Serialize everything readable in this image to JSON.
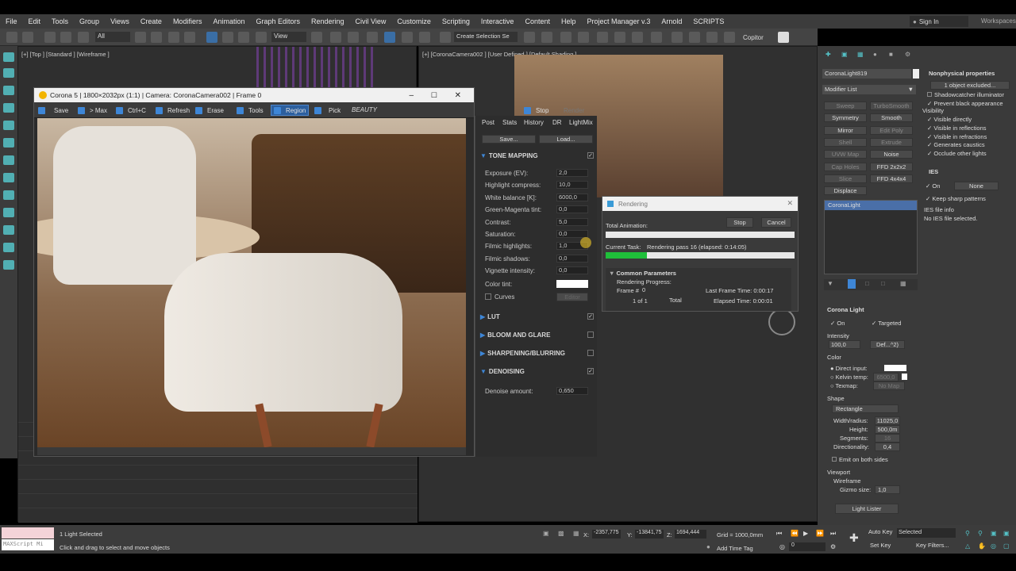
{
  "menu": [
    "File",
    "Edit",
    "Tools",
    "Group",
    "Views",
    "Create",
    "Modifiers",
    "Animation",
    "Graph Editors",
    "Rendering",
    "Civil View",
    "Customize",
    "Scripting",
    "Interactive",
    "Content",
    "Help",
    "Project Manager v.3",
    "Arnold",
    "SCRIPTS"
  ],
  "signin": "Sign In",
  "workspaces": "Workspaces",
  "toolbar": {
    "filter": "All",
    "view": "View",
    "selset": "Create Selection Se",
    "copitor": "Copitor"
  },
  "viewports": {
    "top": "[+] [Top ] [Standard ] [Wireframe ]",
    "camera": "[+] [CoronaCamera002 ] [User Defined ] [Default Shading ]"
  },
  "corona": {
    "title": "Corona 5 | 1800×2032px (1:1) | Camera: CoronaCamera002 | Frame 0",
    "buttons": [
      "Save",
      "> Max",
      "Ctrl+C",
      "Refresh",
      "Erase",
      "Tools",
      "Region",
      "Pick"
    ],
    "channel": "BEAUTY",
    "stop": "Stop",
    "render": "Render"
  },
  "post": {
    "tabs": [
      "Post",
      "Stats",
      "History",
      "DR",
      "LightMix"
    ],
    "save": "Save...",
    "load": "Load...",
    "tone": "TONE MAPPING",
    "params": [
      {
        "l": "Exposure (EV):",
        "v": "2,0"
      },
      {
        "l": "Highlight compress:",
        "v": "10,0"
      },
      {
        "l": "White balance [K]:",
        "v": "6000,0"
      },
      {
        "l": "Green-Magenta tint:",
        "v": "0,0"
      },
      {
        "l": "Contrast:",
        "v": "5,0"
      },
      {
        "l": "Saturation:",
        "v": "0,0"
      },
      {
        "l": "Filmic highlights:",
        "v": "1,0"
      },
      {
        "l": "Filmic shadows:",
        "v": "0,0"
      },
      {
        "l": "Vignette intensity:",
        "v": "0,0"
      }
    ],
    "colortint": "Color tint:",
    "curves": "Curves",
    "editor": "Editor",
    "lut": "LUT",
    "bloom": "BLOOM AND GLARE",
    "sharp": "SHARPENING/BLURRING",
    "denoise": "DENOISING",
    "denoiseamt": "Denoise amount:",
    "denoiseval": "0,650"
  },
  "rendering": {
    "title": "Rendering",
    "total": "Total Animation:",
    "stop": "Stop",
    "cancel": "Cancel",
    "task": "Current Task:",
    "taskval": "Rendering pass 16 (elapsed: 0:14:05)",
    "progress": 0.22,
    "common": "Common Parameters",
    "rprog": "Rendering Progress:",
    "frame": "Frame #",
    "frameval": "0",
    "last": "Last Frame Time: 0:00:17",
    "of": "1 of 1",
    "totallbl": "Total",
    "elapsed": "Elapsed Time: 0:00:01"
  },
  "cmd": {
    "objname": "CoronaLight819",
    "modlist": "Modifier List",
    "mods": [
      [
        "Sweep",
        "TurboSmooth"
      ],
      [
        "Symmetry",
        "Smooth"
      ],
      [
        "Mirror",
        "Edit Poly"
      ],
      [
        "Shell",
        "Extrude"
      ],
      [
        "UVW Map",
        "Noise"
      ],
      [
        "Cap Holes",
        "FFD 2x2x2"
      ],
      [
        "Slice",
        "FFD 4x4x4"
      ],
      [
        "Displace",
        ""
      ]
    ],
    "stack": "CoronaLight",
    "np": "Nonphysical properties",
    "excluded": "1 object excluded...",
    "shadow": "Shadowcatcher illuminator",
    "prevent": "Prevent black appearance",
    "visibility": "Visibility",
    "vis": [
      "Visible directly",
      "Visible in reflections",
      "Visible in refractions",
      "Generates caustics",
      "Occlude other lights"
    ],
    "ies": "IES",
    "on": "On",
    "none": "None",
    "keep": "Keep sharp patterns",
    "iesinfo": "IES file info",
    "noies": "No IES file selected.",
    "cl": "Corona Light",
    "targeted": "Targeted",
    "intensity": "Intensity",
    "intval": "100,0",
    "unit": "Def...^2)",
    "color": "Color",
    "direct": "Direct input:",
    "kelvin": "Kelvin temp:",
    "kelval": "6500,0",
    "texmap": "Texmap:",
    "nomap": "No Map",
    "shape": "Shape",
    "rect": "Rectangle",
    "width": "Width/radius:",
    "widthval": "11025,0",
    "height": "Height:",
    "heightval": "500,0m",
    "segments": "Segments:",
    "segval": "16",
    "direct2": "Directionality:",
    "dirval": "0,4",
    "emit": "Emit on both sides",
    "viewport": "Viewport",
    "wire": "Wireframe",
    "gizmo": "Gizmo size:",
    "gizval": "1,0",
    "lister": "Light Lister"
  },
  "status": {
    "maxscript": "MAXScript Mi",
    "sel": "1 Light Selected",
    "hint": "Click and drag to select and move objects",
    "x": "-2357,775",
    "y": "-13841,75",
    "z": "1694,444",
    "grid": "Grid = 1000,0mm",
    "addtime": "Add Time Tag",
    "frame": "0",
    "autokey": "Auto Key",
    "selected": "Selected",
    "setkey": "Set Key",
    "keyfilters": "Key Filters..."
  }
}
